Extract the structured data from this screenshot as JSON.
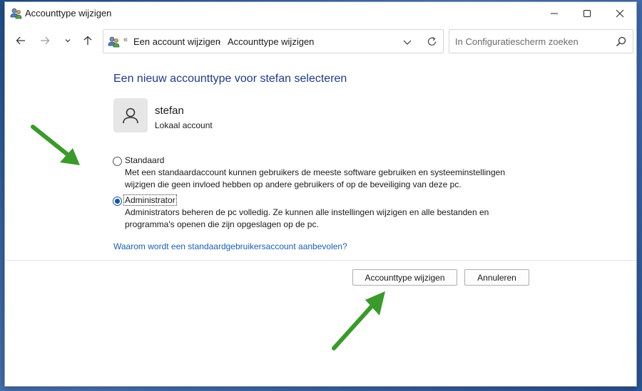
{
  "window": {
    "title": "Accounttype wijzigen"
  },
  "addressbar": {
    "overflow": "«",
    "crumb1": "Een account wijzigen",
    "crumb2": "Accounttype wijzigen"
  },
  "search": {
    "placeholder": "In Configuratiescherm zoeken"
  },
  "content": {
    "heading": "Een nieuw accounttype voor stefan selecteren",
    "user": {
      "name": "stefan",
      "type": "Lokaal account"
    },
    "options": [
      {
        "label": "Standaard",
        "selected": false,
        "desc1": "Met een standaardaccount kunnen gebruikers de meeste software gebruiken en systeeminstellingen",
        "desc2": "wijzigen die geen invloed hebben op andere gebruikers of op de beveiliging van deze pc."
      },
      {
        "label": "Administrator",
        "selected": true,
        "desc1": "Administrators beheren de pc volledig. Ze kunnen alle instellingen wijzigen en alle bestanden en",
        "desc2": "programma's openen die zijn opgeslagen op de pc."
      }
    ],
    "help_link": "Waarom wordt een standaardgebruikersaccount aanbevolen?"
  },
  "buttons": {
    "change": "Accounttype wijzigen",
    "cancel": "Annuleren"
  },
  "colors": {
    "accent": "#1553a7",
    "heading": "#1e3a8a",
    "link": "#1a5fb4",
    "annotation_arrow": "#3a9a2a"
  }
}
